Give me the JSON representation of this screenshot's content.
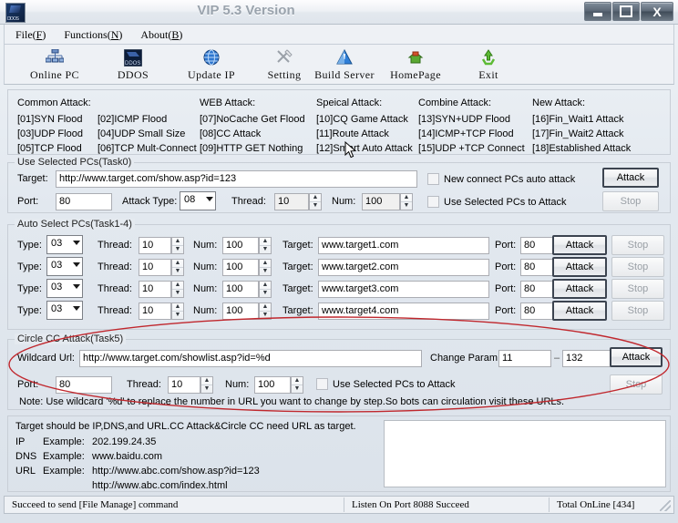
{
  "window": {
    "title": "VIP 5.3 Version",
    "icon": "app-ddos-icon",
    "buttons": {
      "minimize": "–",
      "maximize": "▫",
      "close": "X"
    }
  },
  "menu": [
    {
      "label": "File",
      "accel": "F"
    },
    {
      "label": "Functions",
      "accel": "N"
    },
    {
      "label": "About",
      "accel": "B"
    }
  ],
  "toolbar": [
    {
      "label": "Online PC",
      "icon": "network-icon"
    },
    {
      "label": "DDOS",
      "icon": "ddos-icon"
    },
    {
      "label": "Update IP",
      "icon": "globe-icon"
    },
    {
      "label": "Setting",
      "icon": "tools-icon"
    },
    {
      "label": "Build Server",
      "icon": "build-icon"
    },
    {
      "label": "HomePage",
      "icon": "home-icon"
    },
    {
      "label": "Exit",
      "icon": "exit-icon"
    }
  ],
  "attack_types": [
    {
      "header": "Common Attack:",
      "items": [
        "[01]SYN Flood",
        "[02]ICMP Flood",
        "[03]UDP Flood",
        "[04]UDP Small Size",
        "[05]TCP Flood",
        "[06]TCP Mult-Connect"
      ]
    },
    {
      "header": "WEB Attack:",
      "items": [
        "[07]NoCache Get Flood",
        "[08]CC Attack",
        "[09]HTTP GET Nothing"
      ]
    },
    {
      "header": "Speical Attack:",
      "items": [
        "[10]CQ Game Attack",
        "[11]Route Attack",
        "[12]Smart Auto Attack"
      ]
    },
    {
      "header": "Combine Attack:",
      "items": [
        "[13]SYN+UDP Flood",
        "[14]ICMP+TCP Flood",
        "[15]UDP +TCP Connect"
      ]
    },
    {
      "header": "New Attack:",
      "items": [
        "[16]Fin_Wait1 Attack",
        "[17]Fin_Wait2 Attack",
        "[18]Established Attack"
      ]
    }
  ],
  "task0": {
    "legend": "Use Selected PCs(Task0)",
    "target_label": "Target:",
    "target_value": "http://www.target.com/show.asp?id=123",
    "port_label": "Port:",
    "port_value": "80",
    "attack_type_label": "Attack Type:",
    "attack_type_value": "08",
    "thread_label": "Thread:",
    "thread_value": "10",
    "num_label": "Num:",
    "num_value": "100",
    "check_auto": "New connect PCs auto attack",
    "check_selected": "Use Selected PCs to Attack",
    "attack_button": "Attack",
    "stop_button": "Stop"
  },
  "task14": {
    "legend": "Auto Select PCs(Task1-4)",
    "labels": {
      "type": "Type:",
      "thread": "Thread:",
      "num": "Num:",
      "target": "Target:",
      "port": "Port:"
    },
    "attack_button": "Attack",
    "stop_button": "Stop",
    "rows": [
      {
        "type": "03",
        "thread": "10",
        "num": "100",
        "target": "www.target1.com",
        "port": "80"
      },
      {
        "type": "03",
        "thread": "10",
        "num": "100",
        "target": "www.target2.com",
        "port": "80"
      },
      {
        "type": "03",
        "thread": "10",
        "num": "100",
        "target": "www.target3.com",
        "port": "80"
      },
      {
        "type": "03",
        "thread": "10",
        "num": "100",
        "target": "www.target4.com",
        "port": "80"
      }
    ]
  },
  "task5": {
    "legend": "Circle CC Attack(Task5)",
    "wildcard_label": "Wildcard Url:",
    "wildcard_value": "http://www.target.com/showlist.asp?id=%d",
    "change_param_label": "Change Param:",
    "change_param_from": "11",
    "change_param_to": "132",
    "port_label": "Port:",
    "port_value": "80",
    "thread_label": "Thread:",
    "thread_value": "10",
    "num_label": "Num:",
    "num_value": "100",
    "check_selected": "Use Selected PCs to Attack",
    "attack_button": "Attack",
    "stop_button": "Stop",
    "note": "Note: Use wildcard '%d' to replace the number in URL you want to change by step.So bots can circulation visit these URLs."
  },
  "help": {
    "line1": "Target should be IP,DNS,and URL.CC Attack&Circle CC need URL as target.",
    "line2_a": "IP",
    "line2_b": "Example:",
    "line2_c": "202.199.24.35",
    "line3_a": "DNS",
    "line3_b": "Example:",
    "line3_c": "www.baidu.com",
    "line4_a": "URL",
    "line4_b": "Example:",
    "line4_c": "http://www.abc.com/show.asp?id=123",
    "line5_c": "http://www.abc.com/index.html"
  },
  "statusbar": {
    "message": "Succeed to send [File Manage] command",
    "listen": "Listen On Port 8088 Succeed",
    "online": "Total OnLine [434]"
  },
  "annotation": {
    "shape": "red-ellipse-highlight"
  },
  "colors": {
    "accent_red": "#c0272d",
    "title_text": "#9aa3ad",
    "window_bg": "#e5eaf0"
  }
}
